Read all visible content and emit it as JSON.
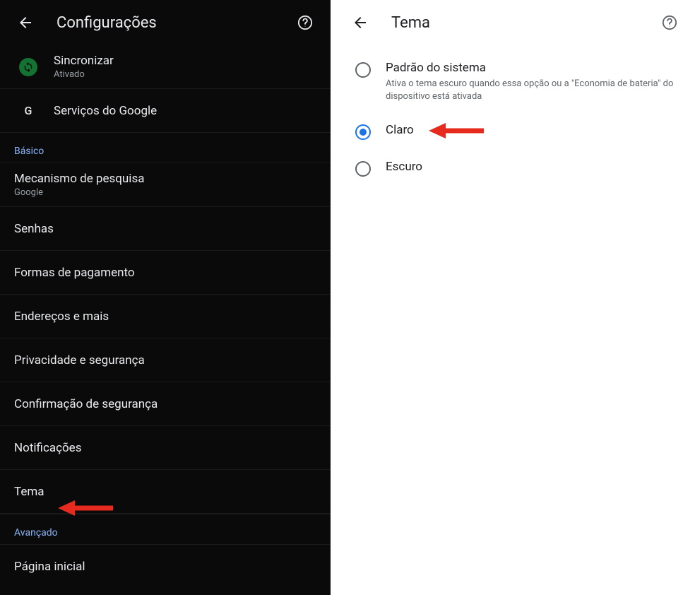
{
  "left": {
    "title": "Configurações",
    "sync": {
      "label": "Sincronizar",
      "sub": "Ativado"
    },
    "google_services": "Serviços do Google",
    "section_basic": "Básico",
    "search_engine": {
      "label": "Mecanismo de pesquisa",
      "sub": "Google"
    },
    "passwords": "Senhas",
    "payment": "Formas de pagamento",
    "addresses": "Endereços e mais",
    "privacy": "Privacidade e segurança",
    "security_confirm": "Confirmação de segurança",
    "notifications": "Notificações",
    "theme": "Tema",
    "section_advanced": "Avançado",
    "homepage": "Página inicial"
  },
  "right": {
    "title": "Tema",
    "options": {
      "system": {
        "label": "Padrão do sistema",
        "desc": "Ativa o tema escuro quando essa opção ou a \"Economia de bateria\" do dispositivo está ativada"
      },
      "light": {
        "label": "Claro"
      },
      "dark": {
        "label": "Escuro"
      }
    }
  }
}
